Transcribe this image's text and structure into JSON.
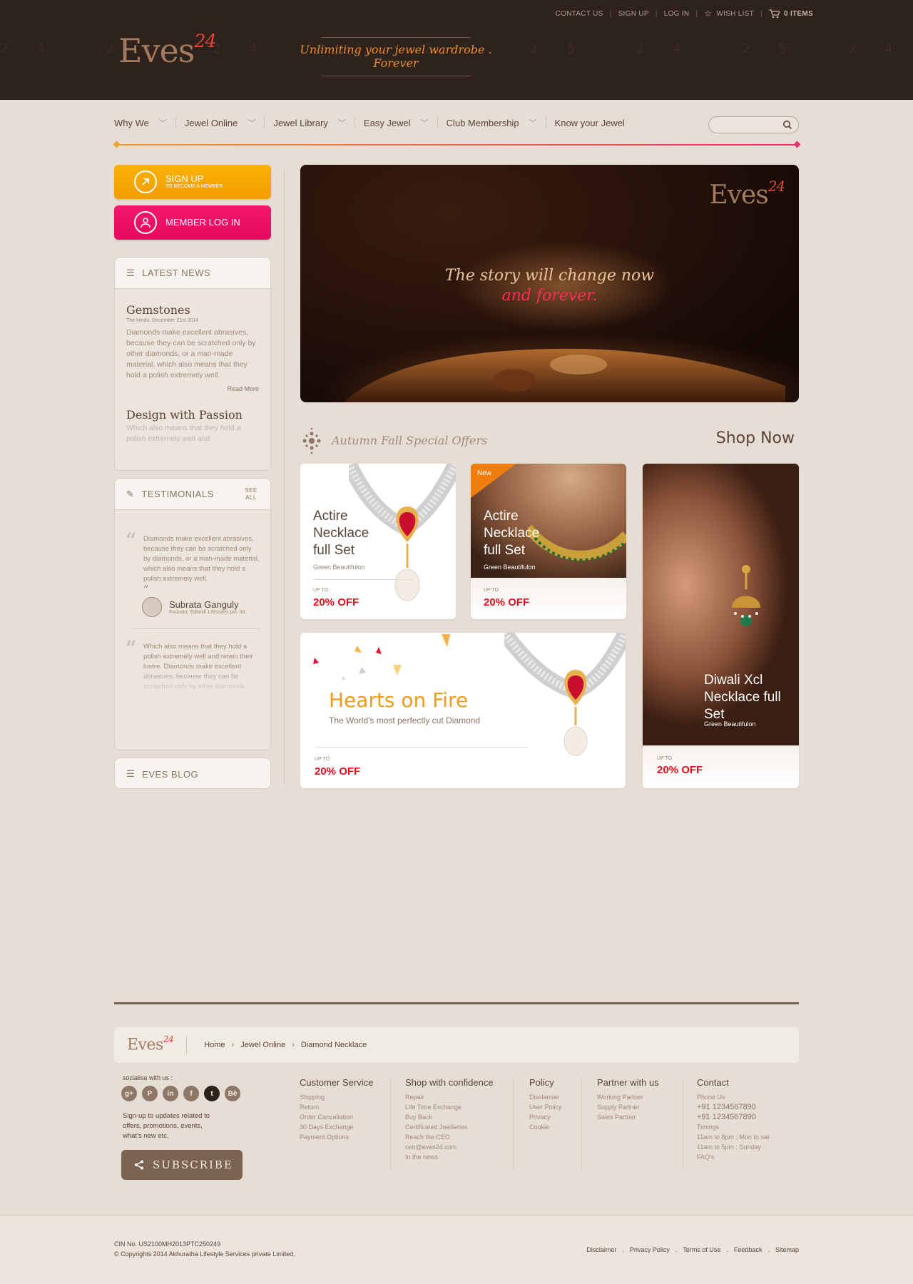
{
  "header": {
    "top_links": [
      "CONTACT US",
      "SIGN UP",
      "LOG IN"
    ],
    "wishlist": "WISH LIST",
    "cart_count": "0 ITEMS",
    "logo_text": "Eves",
    "logo_sup": "24",
    "tagline": "Unlimiting your jewel wardrobe . Forever",
    "digit_strip": "24 25 24 25 24 25 24 25 24 25 24 25 24 25 24 25"
  },
  "nav": {
    "items": [
      "Why We",
      "Jewel Online",
      "Jewel Library",
      "Easy Jewel",
      "Club Membership",
      "Know your Jewel"
    ],
    "search_placeholder": ""
  },
  "sidebar": {
    "signup_label": "SIGN UP",
    "signup_sub": "TO BECOME A MEMBER",
    "login_label": "MEMBER LOG IN",
    "news_heading": "LATEST NEWS",
    "news": [
      {
        "title": "Gemstones",
        "date": "The Hindu, December 21st 2014",
        "body": "Diamonds make excellent abrasives, because they can be scratched only by other diamonds, or a man-made material, which also means that they hold a polish extremely well.",
        "more": "Read More"
      },
      {
        "title": "Design with Passion",
        "body": "Which also means that they hold a polish extremely well and"
      }
    ],
    "testimonials_heading": "TESTIMONIALS",
    "see_all": "SEE ALL",
    "testimonials": [
      {
        "quote": "Diamonds make excellent abrasives, because they can be scratched only by diamonds, or a man-made material, which also means that they hold a polish extremely well.",
        "name": "Subrata Ganguly",
        "role": "Founder, Edilesh Lifestyles pvt. ltd."
      },
      {
        "quote": "Which also means that they hold a polish extremely well and retain their lustre. Diamonds make excellent abrasives, because they can be scratched only by other diamonds."
      }
    ],
    "blog_heading": "EVES BLOG"
  },
  "hero": {
    "logo_text": "Eves",
    "logo_sup": "24",
    "line1": "The story will change now",
    "line2": "and forever."
  },
  "offers": {
    "label": "Autumn Fall Special Offers",
    "shop_now": "Shop Now",
    "cards": [
      {
        "title": "Actire Necklace full Set",
        "sub": "Green Beautifulon",
        "upto": "UP TO",
        "off": "20% OFF"
      },
      {
        "badge": "New",
        "title": "Actire Necklace full Set",
        "sub": "Green Beautifulon",
        "upto": "UP TO",
        "off": "20% OFF"
      },
      {
        "title": "Diwali Xcl Necklace full Set",
        "sub": "Green Beautifulon",
        "upto": "UP TO",
        "off": "20% OFF"
      },
      {
        "title": "Hearts on Fire",
        "sub": "The World's most perfectly cut Diamond",
        "upto": "UP TO",
        "off": "20% OFF"
      }
    ]
  },
  "footer": {
    "logo_text": "Eves",
    "logo_sup": "24",
    "breadcrumb": [
      "Home",
      "Jewel Online",
      "Diamond Necklace"
    ],
    "social_label": "socialise with us :",
    "social": [
      "g+",
      "P",
      "in",
      "f",
      "t",
      "Bē"
    ],
    "signup_text": "Sign-up to updates related to offers, promotions, events, what's new etc.",
    "subscribe": "SUBSCRIBE",
    "columns": [
      {
        "title": "Customer Service",
        "links": [
          "Shipping",
          "Return",
          "Order Cancellation",
          "30 Days Exchange",
          "Payment Options"
        ]
      },
      {
        "title": "Shop with confidence",
        "links": [
          "Repair",
          "Life Time Exchange",
          "Buy Back",
          "Certificated Jwelleries",
          "Reach the CEO",
          "ceo@eves24.com",
          "In the news"
        ]
      },
      {
        "title": "Policy",
        "links": [
          "Disclamiar",
          "User Policy",
          "Privacy",
          "Cookie"
        ]
      },
      {
        "title": "Partner with us",
        "links": [
          "Working Partner",
          "Supply Partner",
          "Sales Partner"
        ]
      },
      {
        "title": "Contact",
        "links": [
          "Phone Us",
          "+91 1234567890",
          "+91 1234567890",
          "Timings",
          "11am to 8pm : Mon to sat",
          "11am to 5pm : Sunday",
          "FAQ's"
        ]
      }
    ],
    "cin": "CIN No. US2100MH2013PTC250249",
    "copyright": "© Copyrights 2014 Akhuratha Lifestyle Services private Limited.",
    "bottom_links": [
      "Disclaimer",
      "Privacy Policy",
      "Terms of Use",
      "Feedback",
      "Sitemap"
    ]
  },
  "colors": {
    "header_bg": "#2d221c",
    "page_bg": "#e6ddd4",
    "signup_orange": "#f5a500",
    "login_pink": "#ec0f63",
    "offer_red": "#e3101c",
    "accent_orange": "#f08c2e"
  },
  "icons": [
    "star-icon",
    "cart-icon",
    "search-icon",
    "arrow-icon",
    "user-icon",
    "list-icon",
    "edit-icon",
    "ornament-icon",
    "share-icon"
  ]
}
